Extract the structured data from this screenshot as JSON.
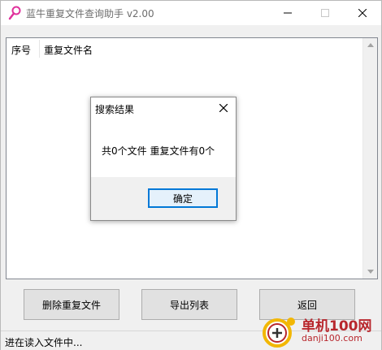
{
  "window": {
    "title": "蓝牛重复文件查询助手 v2.00",
    "icons": {
      "app": "magnifier-app-icon",
      "minimize": "minimize-icon",
      "maximize": "maximize-icon",
      "close": "close-icon"
    }
  },
  "list": {
    "columns": [
      "序号",
      "重复文件名"
    ],
    "rows": []
  },
  "buttons": {
    "delete": "删除重复文件",
    "export": "导出列表",
    "back": "返回"
  },
  "status": {
    "text": "进在读入文件中..."
  },
  "dialog": {
    "title": "搜索结果",
    "message": "共0个文件 重复文件有0个",
    "ok": "确定"
  },
  "watermark": {
    "name": "单机100网",
    "url": "danji100.com"
  },
  "colors": {
    "accent": "#0078d7",
    "watermark": "#b8272d",
    "icon": "#e0319c"
  }
}
